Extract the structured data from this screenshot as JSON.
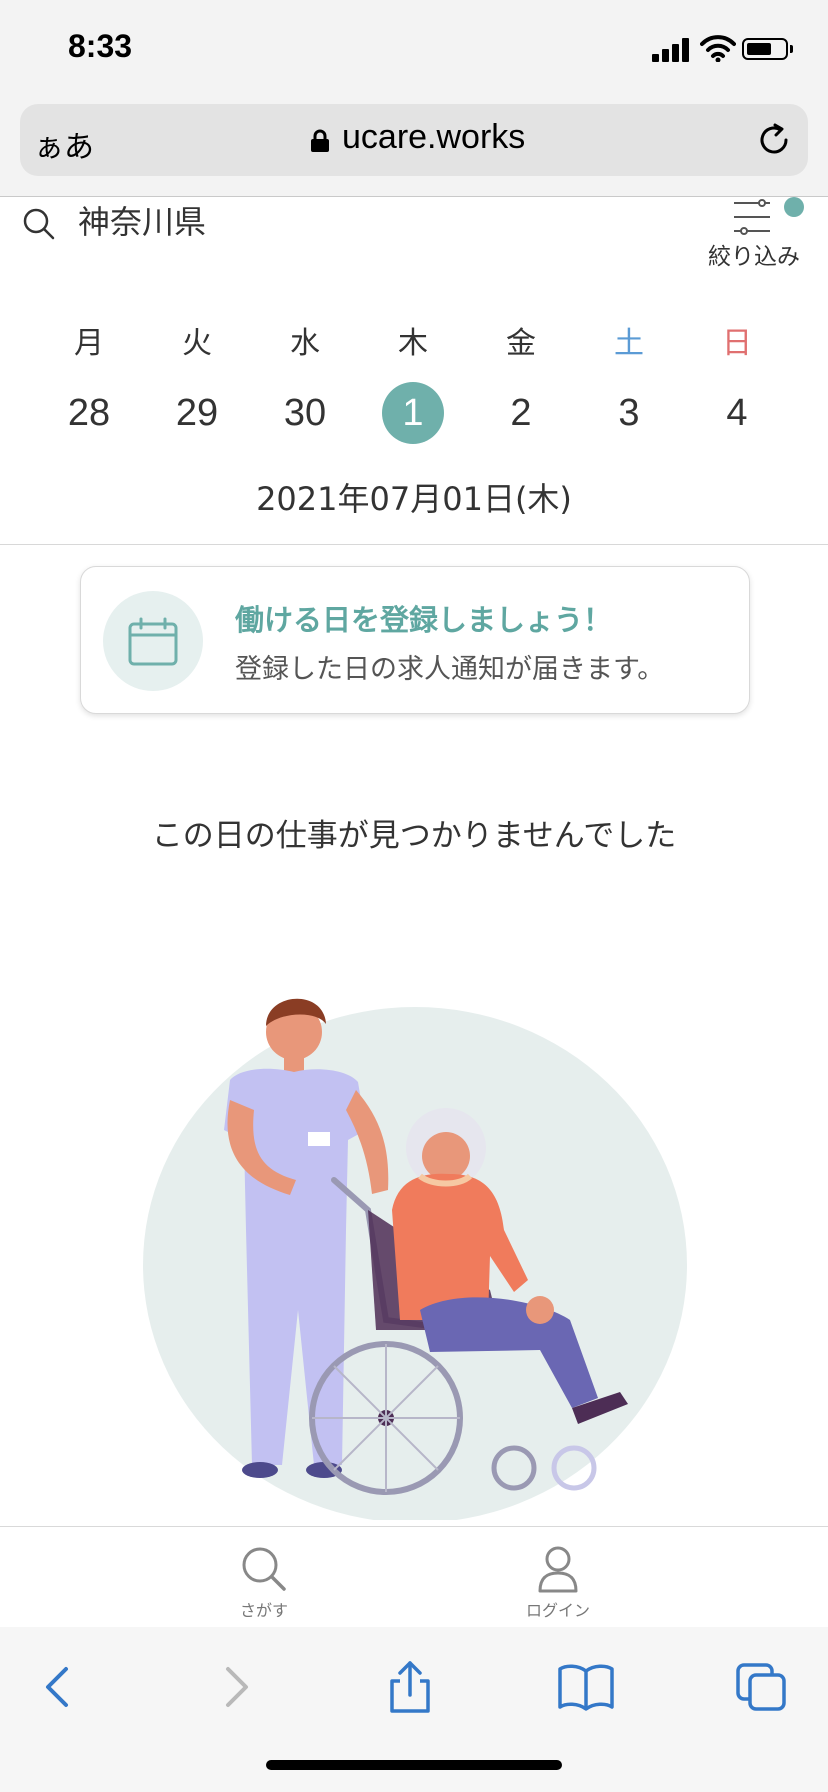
{
  "status_bar": {
    "time": "8:33"
  },
  "browser": {
    "text_size_label": "ぁあ",
    "url": "ucare.works"
  },
  "search": {
    "query": "神奈川県",
    "filter_label": "絞り込み"
  },
  "week": {
    "days": [
      {
        "dow": "月",
        "num": "28"
      },
      {
        "dow": "火",
        "num": "29"
      },
      {
        "dow": "水",
        "num": "30"
      },
      {
        "dow": "木",
        "num": "1",
        "selected": true
      },
      {
        "dow": "金",
        "num": "2"
      },
      {
        "dow": "土",
        "num": "3"
      },
      {
        "dow": "日",
        "num": "4"
      }
    ],
    "selected_date_label": "2021年07月01日(木)"
  },
  "banner": {
    "title": "働ける日を登録しましょう！",
    "subtitle": "登録した日の求人通知が届きます。"
  },
  "empty_message": "この日の仕事が見つかりませんでした",
  "tabs": [
    {
      "label": "さがす"
    },
    {
      "label": "ログイン"
    }
  ],
  "colors": {
    "accent": "#6fb0ab",
    "saturday": "#5b9bd5",
    "sunday": "#e07070"
  }
}
